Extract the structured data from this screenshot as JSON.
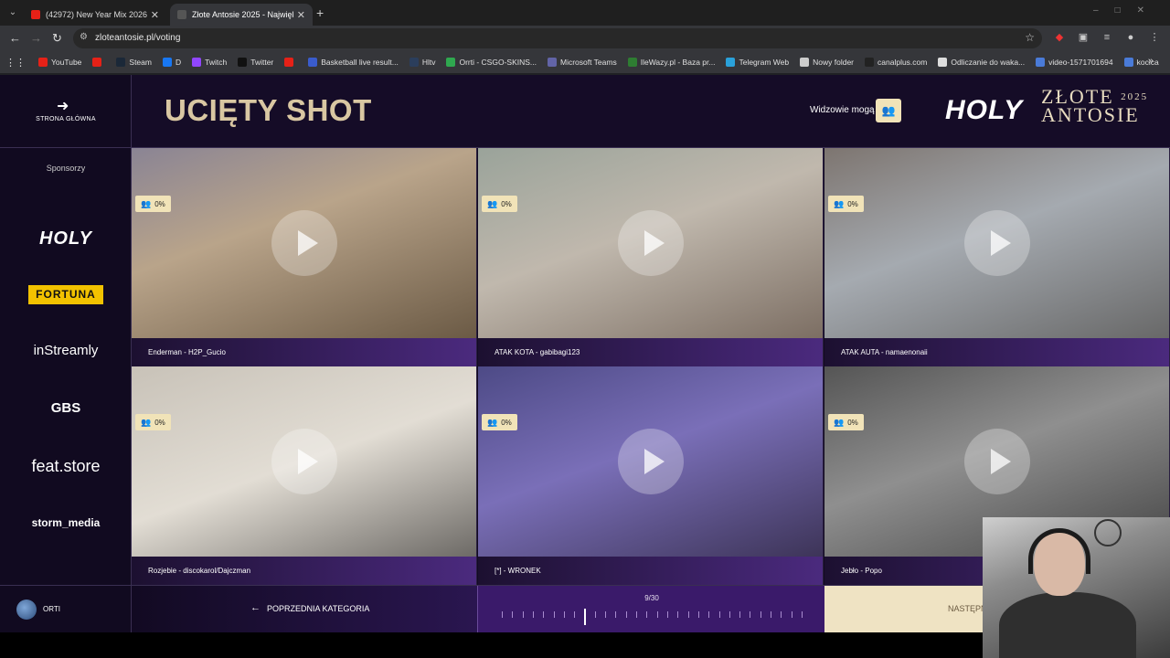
{
  "browser": {
    "tabs": [
      {
        "title": "(42972) New Year Mix 2026 | Th",
        "favicon_color": "#e62117"
      },
      {
        "title": "Złote Antosie 2025 - Największ",
        "favicon_color": "#3a3a3a"
      }
    ],
    "url": "zloteantosie.pl/voting",
    "bookmarks": [
      {
        "label": "YouTube",
        "color": "#e62117"
      },
      {
        "label": "",
        "color": "#e62117"
      },
      {
        "label": "Steam",
        "color": "#1b2838"
      },
      {
        "label": "D",
        "color": "#1877f2"
      },
      {
        "label": "Twitch",
        "color": "#9146ff"
      },
      {
        "label": "Twitter",
        "color": "#111111"
      },
      {
        "label": "",
        "color": "#e62117"
      },
      {
        "label": "Basketball live result...",
        "color": "#3a5ccc"
      },
      {
        "label": "Hltv",
        "color": "#2b3e5c"
      },
      {
        "label": "Orrti - CSGO-SKINS...",
        "color": "#2fa84f"
      },
      {
        "label": "Microsoft Teams",
        "color": "#6264a7"
      },
      {
        "label": "IleWazy.pl - Baza pr...",
        "color": "#2e7d32"
      },
      {
        "label": "Telegram Web",
        "color": "#2aa1da"
      },
      {
        "label": "Nowy folder",
        "color": "#cccccc"
      },
      {
        "label": "canalplus.com",
        "color": "#222222"
      },
      {
        "label": "Odliczanie do waka...",
        "color": "#dddddd"
      },
      {
        "label": "video-1571701694",
        "color": "#4a7bd8"
      },
      {
        "label": "kocica",
        "color": "#4a7bd8"
      }
    ]
  },
  "sidebar": {
    "back_label": "STRONA GŁÓWNA",
    "sponsors_title": "Sponsorzy",
    "sponsors": [
      "HOLY",
      "FORTUNA",
      "inStreamly",
      "GBS",
      "feat.store",
      "storm_media"
    ],
    "user": "ORTI"
  },
  "header": {
    "category_title": "UCIĘTY SHOT",
    "viewers_label": "Widzowie mogą",
    "logo_holy": "HOLY",
    "logo_line1": "ZŁOTE",
    "logo_year": "2025",
    "logo_line2": "ANTOSIE"
  },
  "tiles": [
    {
      "caption": "Enderman - H2P_Gucio",
      "percent": "0%",
      "bg": "linear-gradient(160deg,#8a8494 0%,#b9a48a 40%,#6b5a45 100%)"
    },
    {
      "caption": "ATAK KOTA - gabibagi123",
      "percent": "0%",
      "bg": "linear-gradient(160deg,#9aa39a 0%,#c0b8ad 45%,#7c6e63 100%)"
    },
    {
      "caption": "ATAK AUTA - namaenonaii",
      "percent": "0%",
      "bg": "linear-gradient(160deg,#7d7570 0%,#a5aab0 45%,#686868 100%)"
    },
    {
      "caption": "Rozjebie - discokarol/Dajczman",
      "percent": "0%",
      "bg": "linear-gradient(160deg,#c8c2b8 0%,#e2ddd4 50%,#6d6a66 100%)"
    },
    {
      "caption": "[*] - WRONEK",
      "percent": "0%",
      "bg": "linear-gradient(160deg,#4d4a86 0%,#7a6fb8 45%,#3d3458 100%)"
    },
    {
      "caption": "Jebło - Popo",
      "percent": "0%",
      "bg": "linear-gradient(160deg,#555555 0%,#8f8f8f 45%,#444444 100%)"
    }
  ],
  "footer": {
    "prev_label": "POPRZEDNIA KATEGORIA",
    "progress_text": "9/30",
    "progress_current": 9,
    "progress_total": 30,
    "next_label": "NASTĘPN"
  }
}
